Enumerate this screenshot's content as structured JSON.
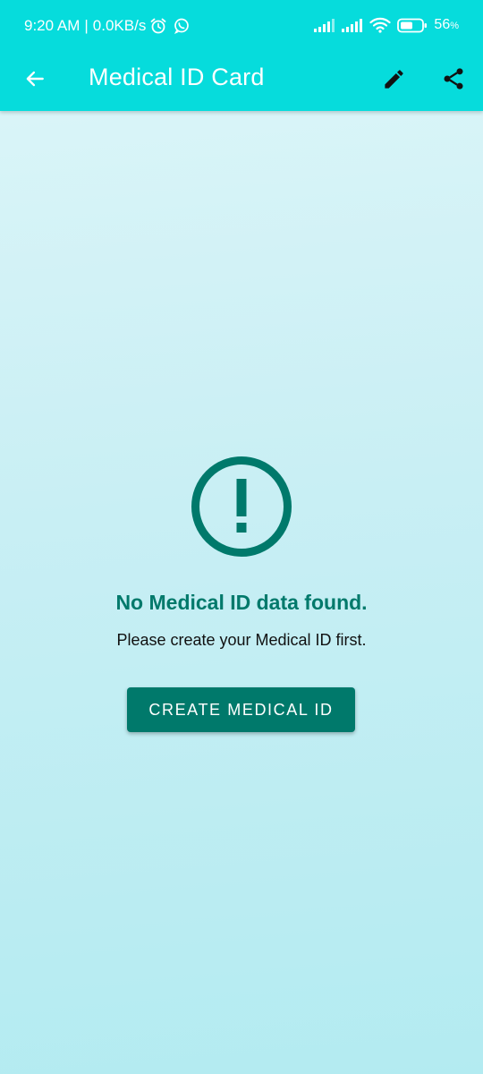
{
  "status_bar": {
    "time": "9:20 AM",
    "separator": "|",
    "network_speed": "0.0KB/s",
    "battery_level": "56",
    "battery_unit": "%",
    "icons": [
      "alarm-icon",
      "whatsapp-icon",
      "signal-icon",
      "signal-icon",
      "wifi-icon",
      "battery-icon"
    ]
  },
  "app_bar": {
    "title": "Medical ID Card",
    "background_color": "#06dcdc",
    "actions": [
      "back-arrow-icon",
      "edit-pencil-icon",
      "share-icon"
    ]
  },
  "empty_state": {
    "icon": "exclamation-circle-icon",
    "title": "No Medical ID data found.",
    "subtitle": "Please create your Medical ID first.",
    "button_label": "CREATE MEDICAL ID",
    "accent_color": "#00796b"
  }
}
